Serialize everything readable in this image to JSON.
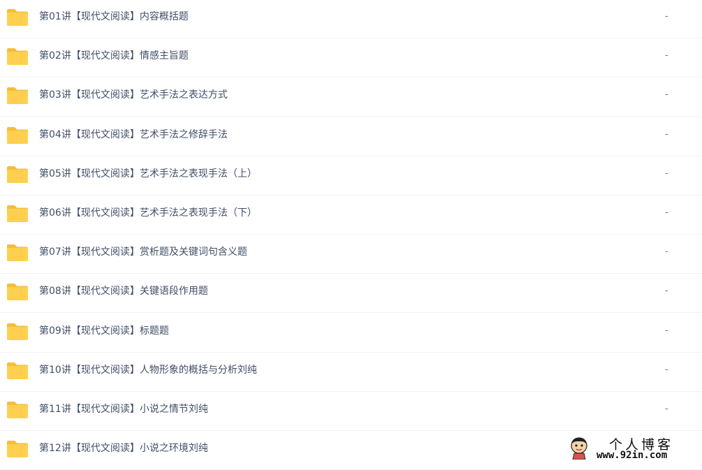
{
  "colors": {
    "folder": "#ffd04f",
    "folder_tab": "#f5bd3c",
    "text": "#424e67",
    "divider": "#f1f2f4"
  },
  "icons": {
    "row_icon": "folder-icon",
    "watermark_icon": "cartoon-avatar-icon"
  },
  "files": [
    {
      "name": "第01讲【现代文阅读】内容概括题",
      "size": "-"
    },
    {
      "name": "第02讲【现代文阅读】情感主旨题",
      "size": "-"
    },
    {
      "name": "第03讲【现代文阅读】艺术手法之表达方式",
      "size": "-"
    },
    {
      "name": "第04讲【现代文阅读】艺术手法之修辞手法",
      "size": "-"
    },
    {
      "name": "第05讲【现代文阅读】艺术手法之表现手法（上）",
      "size": "-"
    },
    {
      "name": "第06讲【现代文阅读】艺术手法之表现手法（下）",
      "size": "-"
    },
    {
      "name": "第07讲【现代文阅读】赏析题及关键词句含义题",
      "size": "-"
    },
    {
      "name": "第08讲【现代文阅读】关键语段作用题",
      "size": "-"
    },
    {
      "name": "第09讲【现代文阅读】标题题",
      "size": "-"
    },
    {
      "name": "第10讲【现代文阅读】人物形象的概括与分析刘纯",
      "size": "-"
    },
    {
      "name": "第11讲【现代文阅读】小说之情节刘纯",
      "size": "-"
    },
    {
      "name": "第12讲【现代文阅读】小说之环境刘纯",
      "size": ""
    }
  ],
  "watermark": {
    "title": "个人博客",
    "url": "www.92in.com"
  }
}
